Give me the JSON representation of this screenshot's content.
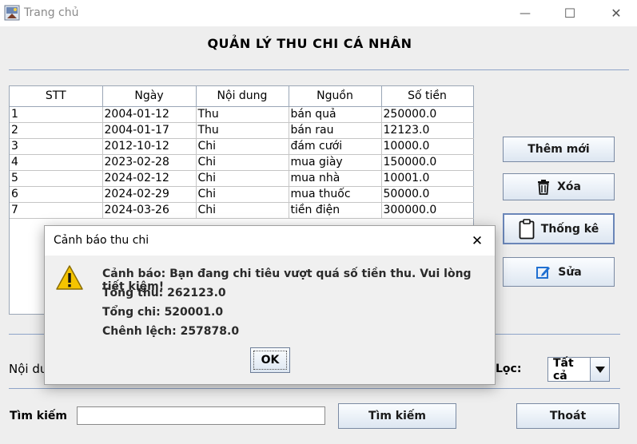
{
  "window": {
    "title": "Trang chủ",
    "minimize_glyph": "—",
    "maximize_glyph": "☐",
    "close_glyph": "✕",
    "icon": "app-window-icon"
  },
  "heading": "QUẢN  LÝ THU CHI CÁ NHÂN",
  "table": {
    "columns": [
      "STT",
      "Ngày",
      "Nội dung",
      "Nguồn",
      "Số tiền"
    ],
    "rows": [
      [
        "1",
        "2004-01-12",
        "Thu",
        "bán quả",
        "250000.0"
      ],
      [
        "2",
        "2004-01-17",
        "Thu",
        "bán rau",
        "12123.0"
      ],
      [
        "3",
        "2012-10-12",
        "Chi",
        "đám cưới",
        "10000.0"
      ],
      [
        "4",
        "2023-02-28",
        "Chi",
        "mua giày",
        "150000.0"
      ],
      [
        "5",
        "2024-02-12",
        "Chi",
        "mua nhà",
        "10001.0"
      ],
      [
        "6",
        "2024-02-29",
        "Chi",
        "mua thuốc",
        "50000.0"
      ],
      [
        "7",
        "2024-03-26",
        "Chi",
        "tiền điện",
        "300000.0"
      ]
    ]
  },
  "buttons": {
    "add": "Thêm mới",
    "delete": "Xóa",
    "stats": "Thống kê",
    "edit": "Sửa",
    "search": "Tìm kiếm",
    "exit": "Thoát"
  },
  "form": {
    "content_label": "Nội du",
    "filter_label": "Lọc:",
    "filter_value": "Tất cả",
    "search_label": "Tìm kiếm",
    "search_value": ""
  },
  "dialog": {
    "title": "Cảnh báo thu chi",
    "message": "Cảnh báo: Bạn đang chi tiêu vượt quá số tiền thu. Vui lòng tiết kiệm!",
    "total_income": "Tổng thu: 262123.0",
    "total_expense": "Tổng chi: 520001.0",
    "difference": "Chênh lệch: 257878.0",
    "ok": "OK",
    "close_glyph": "✕",
    "icon": "warning-icon"
  },
  "colors": {
    "accent_border": "#7a8aa3",
    "warning_yellow": "#f5c400",
    "edit_blue": "#1f6fd1"
  }
}
